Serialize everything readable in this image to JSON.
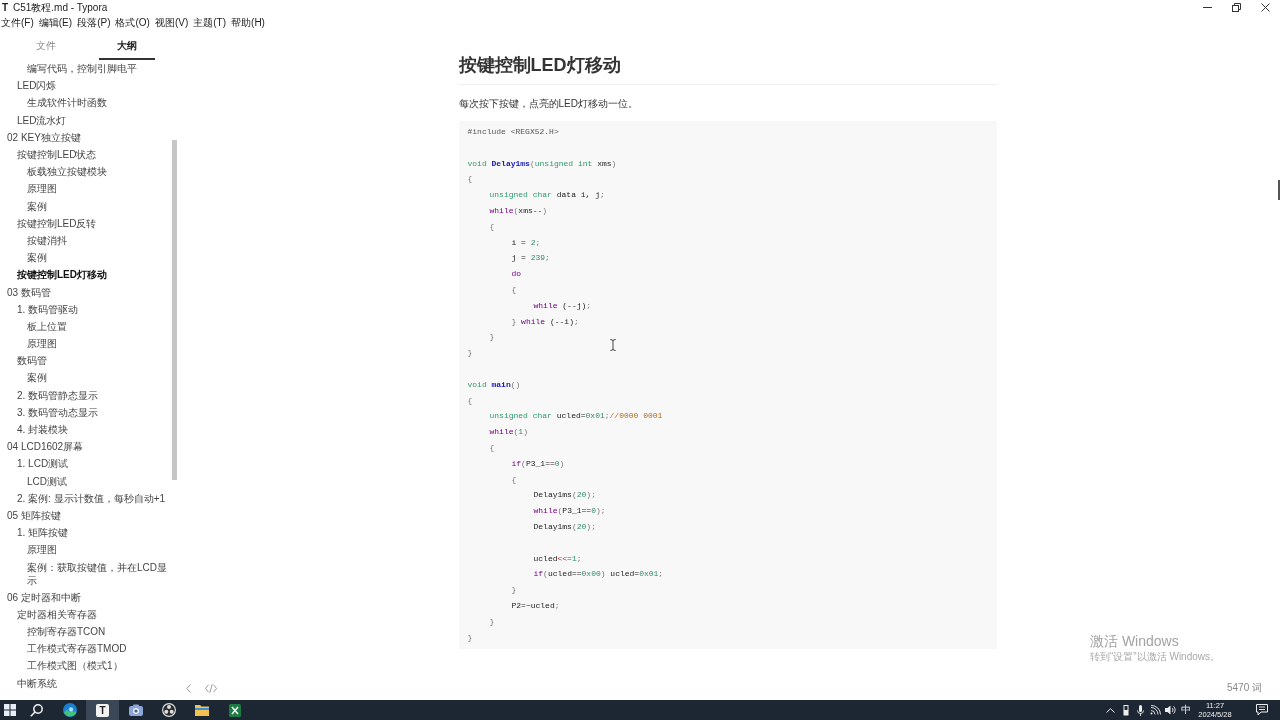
{
  "window": {
    "icon_letter": "T",
    "title": "C51教程.md - Typora"
  },
  "menu": [
    "文件(F)",
    "编辑(E)",
    "段落(P)",
    "格式(O)",
    "视图(V)",
    "主题(T)",
    "帮助(H)"
  ],
  "sidebar": {
    "tabs": [
      {
        "label": "文件",
        "selected": false
      },
      {
        "label": "大纲",
        "selected": true
      }
    ],
    "outline": [
      {
        "children": [
          {
            "children": [
              {
                "label": "编写代码，控制引脚电平",
                "selected": false
              }
            ]
          },
          {
            "label": "LED闪烁",
            "selected": false,
            "children": [
              {
                "label": "生成软件计时函数",
                "selected": false
              }
            ]
          },
          {
            "label": "LED流水灯",
            "selected": false
          }
        ]
      },
      {
        "label": "02 KEY独立按键",
        "selected": false,
        "children": [
          {
            "label": "按键控制LED状态",
            "selected": false,
            "children": [
              {
                "label": "板载独立按键模块",
                "selected": false
              },
              {
                "label": "原理图",
                "selected": false
              },
              {
                "label": "案例",
                "selected": false
              }
            ]
          },
          {
            "label": "按键控制LED反转",
            "selected": false,
            "children": [
              {
                "label": "按键消抖",
                "selected": false
              },
              {
                "label": "案例",
                "selected": false
              }
            ]
          },
          {
            "label": "按键控制LED灯移动",
            "selected": true
          }
        ]
      },
      {
        "label": "03 数码管",
        "selected": false,
        "children": [
          {
            "label": "1. 数码管驱动",
            "selected": false,
            "children": [
              {
                "label": "板上位置",
                "selected": false
              },
              {
                "label": "原理图",
                "selected": false
              }
            ]
          },
          {
            "label": "数码管",
            "selected": false,
            "children": [
              {
                "label": "案例",
                "selected": false
              }
            ]
          },
          {
            "label": "2. 数码管静态显示",
            "selected": false
          },
          {
            "label": "3. 数码管动态显示",
            "selected": false
          },
          {
            "label": "4. 封装模块",
            "selected": false
          }
        ]
      },
      {
        "label": "04 LCD1602屏幕",
        "selected": false,
        "children": [
          {
            "label": "1. LCD测试",
            "selected": false,
            "children": [
              {
                "label": "LCD测试",
                "selected": false
              }
            ]
          },
          {
            "label": "2. 案例: 显示计数值，每秒自动+1",
            "selected": false
          }
        ]
      },
      {
        "label": "05 矩阵按键",
        "selected": false,
        "children": [
          {
            "label": "1. 矩阵按键",
            "selected": false,
            "children": [
              {
                "label": "原理图",
                "selected": false
              },
              {
                "label": "案例：获取按键值，并在LCD显示",
                "selected": false
              }
            ]
          }
        ]
      },
      {
        "label": "06 定时器和中断",
        "selected": false,
        "children": [
          {
            "label": "定时器相关寄存器",
            "selected": false,
            "children": [
              {
                "label": "控制寄存器TCON",
                "selected": false
              },
              {
                "label": "工作模式寄存器TMOD",
                "selected": false
              },
              {
                "label": "工作模式图（模式1）",
                "selected": false
              }
            ]
          },
          {
            "label": "中断系统",
            "selected": false
          }
        ]
      }
    ]
  },
  "document": {
    "heading": "按键控制LED灯移动",
    "paragraph": "每次按下按键，点亮的LED灯移动一位。",
    "code": [
      {
        "kind": "line",
        "tokens": [
          {
            "kind": "meta",
            "text": "#include <REGX52.H>"
          }
        ]
      },
      {
        "kind": "blank"
      },
      {
        "kind": "line",
        "tokens": [
          {
            "kind": "type",
            "text": "void "
          },
          {
            "kind": "def",
            "text": "Delay1ms"
          },
          {
            "kind": "punct",
            "text": "("
          },
          {
            "kind": "type",
            "text": "unsigned int"
          },
          {
            "kind": "plain",
            "text": " xms"
          },
          {
            "kind": "punct",
            "text": ")"
          }
        ]
      },
      {
        "kind": "line",
        "tokens": [
          {
            "kind": "punct",
            "text": "{"
          }
        ],
        "children": [
          {
            "kind": "line",
            "tokens": [
              {
                "kind": "type",
                "text": "unsigned char"
              },
              {
                "kind": "plain",
                "text": " data i, j"
              },
              {
                "kind": "punct",
                "text": ";"
              }
            ]
          },
          {
            "kind": "line",
            "tokens": [
              {
                "kind": "keyword",
                "text": "while"
              },
              {
                "kind": "punct",
                "text": "("
              },
              {
                "kind": "plain",
                "text": "xms--"
              },
              {
                "kind": "punct",
                "text": ")"
              }
            ]
          },
          {
            "kind": "line",
            "tokens": [
              {
                "kind": "punct",
                "text": "{"
              }
            ],
            "children": [
              {
                "kind": "line",
                "tokens": [
                  {
                    "kind": "plain",
                    "text": "i = "
                  },
                  {
                    "kind": "number",
                    "text": "2"
                  },
                  {
                    "kind": "punct",
                    "text": ";"
                  }
                ]
              },
              {
                "kind": "line",
                "tokens": [
                  {
                    "kind": "plain",
                    "text": "j = "
                  },
                  {
                    "kind": "number",
                    "text": "239"
                  },
                  {
                    "kind": "punct",
                    "text": ";"
                  }
                ]
              },
              {
                "kind": "line",
                "tokens": [
                  {
                    "kind": "keyword",
                    "text": "do"
                  }
                ]
              },
              {
                "kind": "line",
                "tokens": [
                  {
                    "kind": "punct",
                    "text": "{"
                  }
                ],
                "children": [
                  {
                    "kind": "line",
                    "tokens": [
                      {
                        "kind": "keyword",
                        "text": "while"
                      },
                      {
                        "kind": "plain",
                        "text": " (--j)"
                      },
                      {
                        "kind": "punct",
                        "text": ";"
                      }
                    ]
                  }
                ]
              },
              {
                "kind": "line",
                "tokens": [
                  {
                    "kind": "punct",
                    "text": "} "
                  },
                  {
                    "kind": "keyword",
                    "text": "while"
                  },
                  {
                    "kind": "plain",
                    "text": " (--i)"
                  },
                  {
                    "kind": "punct",
                    "text": ";"
                  }
                ]
              }
            ]
          },
          {
            "kind": "line",
            "tokens": [
              {
                "kind": "punct",
                "text": "}"
              }
            ]
          }
        ]
      },
      {
        "kind": "line",
        "tokens": [
          {
            "kind": "punct",
            "text": "}"
          }
        ]
      },
      {
        "kind": "blank"
      },
      {
        "kind": "line",
        "tokens": [
          {
            "kind": "type",
            "text": "void "
          },
          {
            "kind": "def",
            "text": "main"
          },
          {
            "kind": "punct",
            "text": "()"
          }
        ]
      },
      {
        "kind": "line",
        "tokens": [
          {
            "kind": "punct",
            "text": "{"
          }
        ],
        "children": [
          {
            "kind": "line",
            "tokens": [
              {
                "kind": "type",
                "text": "unsigned char"
              },
              {
                "kind": "plain",
                "text": " ucled="
              },
              {
                "kind": "number",
                "text": "0x01"
              },
              {
                "kind": "punct",
                "text": ";"
              },
              {
                "kind": "comment",
                "text": "//0000 0001"
              }
            ]
          },
          {
            "kind": "line",
            "tokens": [
              {
                "kind": "keyword",
                "text": "while"
              },
              {
                "kind": "punct",
                "text": "("
              },
              {
                "kind": "number",
                "text": "1"
              },
              {
                "kind": "punct",
                "text": ")"
              }
            ]
          },
          {
            "kind": "line",
            "tokens": [
              {
                "kind": "punct",
                "text": "{"
              }
            ],
            "children": [
              {
                "kind": "line",
                "tokens": [
                  {
                    "kind": "keyword",
                    "text": "if"
                  },
                  {
                    "kind": "punct",
                    "text": "("
                  },
                  {
                    "kind": "plain",
                    "text": "P3_1=="
                  },
                  {
                    "kind": "number",
                    "text": "0"
                  },
                  {
                    "kind": "punct",
                    "text": ")"
                  }
                ]
              },
              {
                "kind": "line",
                "tokens": [
                  {
                    "kind": "punct",
                    "text": "{"
                  }
                ],
                "children": [
                  {
                    "kind": "line",
                    "tokens": [
                      {
                        "kind": "plain",
                        "text": "Delay1ms"
                      },
                      {
                        "kind": "punct",
                        "text": "("
                      },
                      {
                        "kind": "number",
                        "text": "20"
                      },
                      {
                        "kind": "punct",
                        "text": ");"
                      }
                    ]
                  },
                  {
                    "kind": "line",
                    "tokens": [
                      {
                        "kind": "keyword",
                        "text": "while"
                      },
                      {
                        "kind": "punct",
                        "text": "("
                      },
                      {
                        "kind": "plain",
                        "text": "P3_1=="
                      },
                      {
                        "kind": "number",
                        "text": "0"
                      },
                      {
                        "kind": "punct",
                        "text": ");"
                      }
                    ]
                  },
                  {
                    "kind": "line",
                    "tokens": [
                      {
                        "kind": "plain",
                        "text": "Delay1ms"
                      },
                      {
                        "kind": "punct",
                        "text": "("
                      },
                      {
                        "kind": "number",
                        "text": "20"
                      },
                      {
                        "kind": "punct",
                        "text": ");"
                      }
                    ]
                  },
                  {
                    "kind": "blank"
                  },
                  {
                    "kind": "line",
                    "tokens": [
                      {
                        "kind": "plain",
                        "text": "ucled"
                      },
                      {
                        "kind": "operator",
                        "text": "<<="
                      },
                      {
                        "kind": "number",
                        "text": "1"
                      },
                      {
                        "kind": "punct",
                        "text": ";"
                      }
                    ]
                  },
                  {
                    "kind": "line",
                    "tokens": [
                      {
                        "kind": "keyword",
                        "text": "if"
                      },
                      {
                        "kind": "punct",
                        "text": "("
                      },
                      {
                        "kind": "plain",
                        "text": "ucled=="
                      },
                      {
                        "kind": "number",
                        "text": "0x00"
                      },
                      {
                        "kind": "punct",
                        "text": ")"
                      },
                      {
                        "kind": "plain",
                        "text": " ucled="
                      },
                      {
                        "kind": "number",
                        "text": "0x01"
                      },
                      {
                        "kind": "punct",
                        "text": ";"
                      }
                    ]
                  }
                ]
              },
              {
                "kind": "line",
                "tokens": [
                  {
                    "kind": "punct",
                    "text": "}"
                  }
                ]
              },
              {
                "kind": "line",
                "tokens": [
                  {
                    "kind": "plain",
                    "text": "P2=~ucled"
                  },
                  {
                    "kind": "punct",
                    "text": ";"
                  }
                ]
              }
            ]
          },
          {
            "kind": "line",
            "tokens": [
              {
                "kind": "punct",
                "text": "}"
              }
            ]
          }
        ]
      },
      {
        "kind": "line",
        "tokens": [
          {
            "kind": "punct",
            "text": "}"
          }
        ]
      }
    ]
  },
  "footer": {
    "word_count": "5470 词"
  },
  "activation_notice": {
    "title": "激活 Windows",
    "message": "转到“设置”以激活 Windows。"
  },
  "taskbar": {
    "apps": [
      {
        "kind": "start",
        "selected": false
      },
      {
        "kind": "search",
        "selected": false
      },
      {
        "kind": "browser",
        "selected": false
      },
      {
        "kind": "editor",
        "glyph": "T",
        "selected": true
      },
      {
        "kind": "camera",
        "selected": false
      },
      {
        "kind": "recorder",
        "selected": false
      },
      {
        "kind": "folder",
        "selected": false
      },
      {
        "kind": "spreadsheet",
        "selected": false
      }
    ],
    "tray": {
      "input_method": "中",
      "time": "11:27",
      "date": "2024/5/28"
    }
  }
}
